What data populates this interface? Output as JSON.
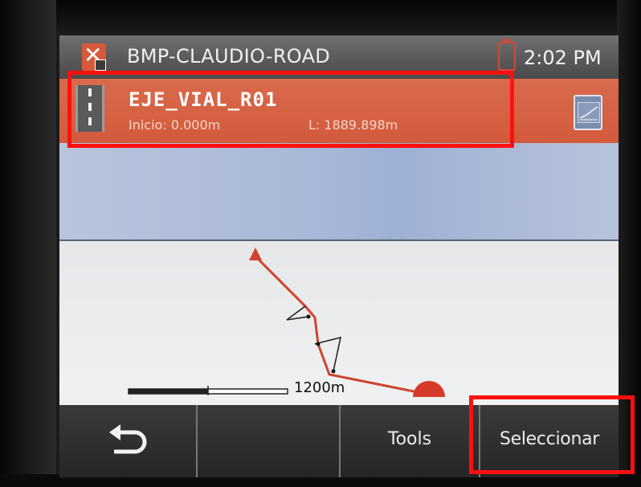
{
  "titlebar": {
    "app_icon": "app-x-icon",
    "title": "BMP-CLAUDIO-ROAD",
    "battery_icon": "battery-icon",
    "time": "2:02 PM"
  },
  "road": {
    "icon": "road-icon",
    "name": "EJE_VIAL_R01",
    "start": "Inicio: 0.000m",
    "length": "L: 1889.898m",
    "profile_icon": "profile-chart-icon"
  },
  "map": {
    "scale_label": "1200m"
  },
  "softkeys": [
    {
      "label": "",
      "icon": "back-arrow-icon"
    },
    {
      "label": ""
    },
    {
      "label": "Tools"
    },
    {
      "label": "Seleccionar"
    }
  ],
  "colors": {
    "accent": "#d35a3c",
    "highlight": "#ff1010",
    "titlebar": "#5c5c5c"
  }
}
